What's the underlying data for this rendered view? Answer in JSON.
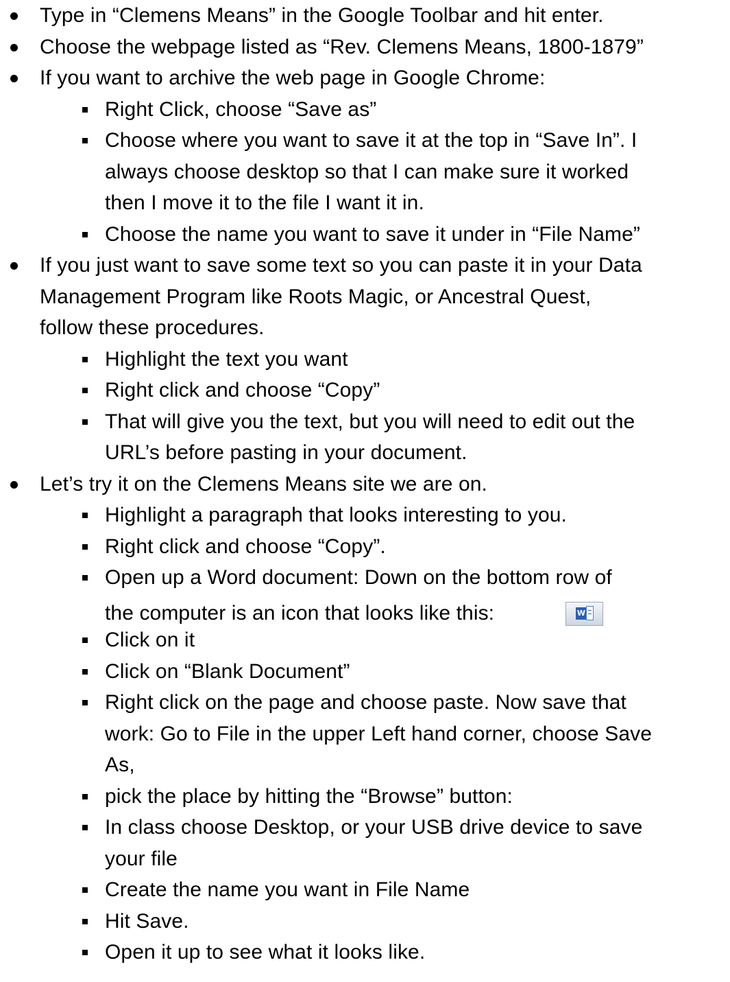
{
  "lines": [
    "Type in “Clemens Means” in the Google Toolbar and hit enter.",
    "Choose the webpage listed as “Rev. Clemens Means, 1800-1879”",
    "If you want to archive the web page in Google Chrome:",
    "Right Click, choose “Save as”",
    "Choose where you want to save it at the top in “Save In”.  I",
    "always choose desktop so that I can make sure it worked",
    "then I move it to the file I want it in.",
    "Choose the name you want to save it under in “File Name”",
    "If you just want to save some text so you can paste it in your Data",
    "Management Program like Roots Magic, or Ancestral Quest,",
    "follow these procedures.",
    "Highlight the text you want",
    "Right click and choose “Copy”",
    "That will give you the text, but you will need to edit out the",
    "URL’s before pasting in your document.",
    "Let’s try it on the Clemens Means site we are on.",
    "Highlight a paragraph that looks interesting to you.",
    "Right click and choose “Copy”.",
    "Open up a Word document: Down on the bottom row of",
    "the computer is an icon that looks like this:",
    "Click on it",
    "Click on “Blank Document”",
    "Right click on the page and choose paste.  Now save that",
    "work: Go to File in the upper Left hand corner, choose Save",
    "As,",
    "pick the place by hitting the “Browse” button:",
    "In class choose Desktop, or your USB drive device to save",
    "your file",
    "Create the name you want in File Name",
    "Hit Save.",
    "Open it up to see what it looks like."
  ],
  "icons": {
    "word_icon": "microsoft-word-icon",
    "word_icon_letter": "W"
  }
}
